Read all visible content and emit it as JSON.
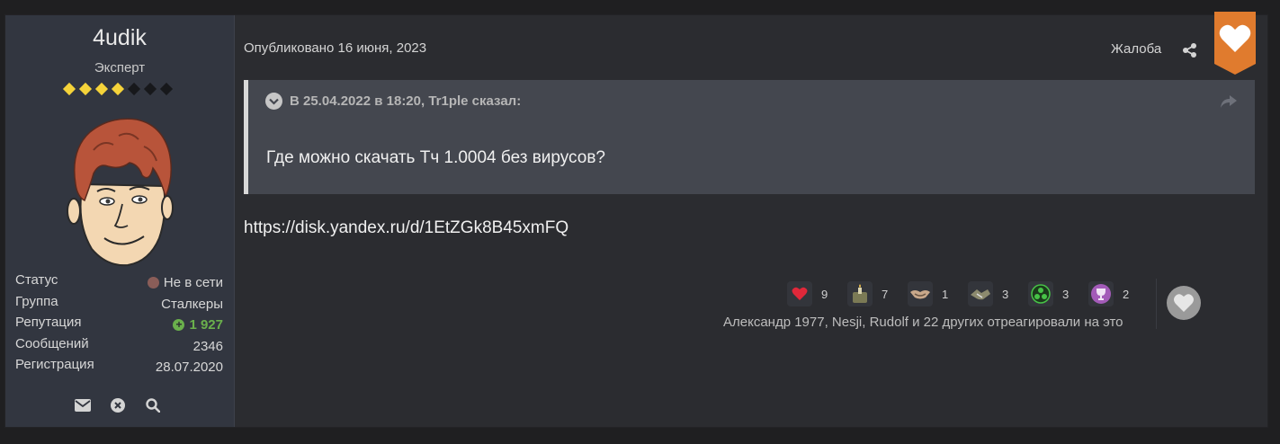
{
  "author": {
    "name": "4udik",
    "title": "Эксперт",
    "rank": {
      "filled": 4,
      "total": 7
    },
    "info": [
      {
        "label": "Статус",
        "value": "Не в сети"
      },
      {
        "label": "Группа",
        "value": "Сталкеры"
      },
      {
        "label": "Репутация",
        "value": "1 927"
      },
      {
        "label": "Сообщений",
        "value": "2346"
      },
      {
        "label": "Регистрация",
        "value": "28.07.2020"
      }
    ],
    "actions": [
      "envelope-icon",
      "block-icon",
      "search-icon"
    ]
  },
  "post": {
    "published": "Опубликовано 16 июня, 2023",
    "report_label": "Жалоба",
    "quote": {
      "header": "В 25.04.2022 в 18:20, Tr1ple сказал:",
      "text": "Где можно скачать Тч 1.0004 без вирусов?"
    },
    "link_text": "https://disk.yandex.ru/d/1EtZGk8B45xmFQ"
  },
  "reactions": {
    "items": [
      {
        "icon": "heart-reaction-icon",
        "count": "9"
      },
      {
        "icon": "candle-reaction-icon",
        "count": "7"
      },
      {
        "icon": "handshake-reaction-icon",
        "count": "1"
      },
      {
        "icon": "handshake-military-reaction-icon",
        "count": "3"
      },
      {
        "icon": "radiation-reaction-icon",
        "count": "3"
      },
      {
        "icon": "trophy-reaction-icon",
        "count": "2"
      }
    ],
    "summary": "Александр 1977, Nesji, Rudolf и 22 других отреагировали на это"
  },
  "colors": {
    "accent_orange": "#e07b2e",
    "reputation_green": "#6ab04c",
    "rank_gold": "#f5d33a"
  }
}
